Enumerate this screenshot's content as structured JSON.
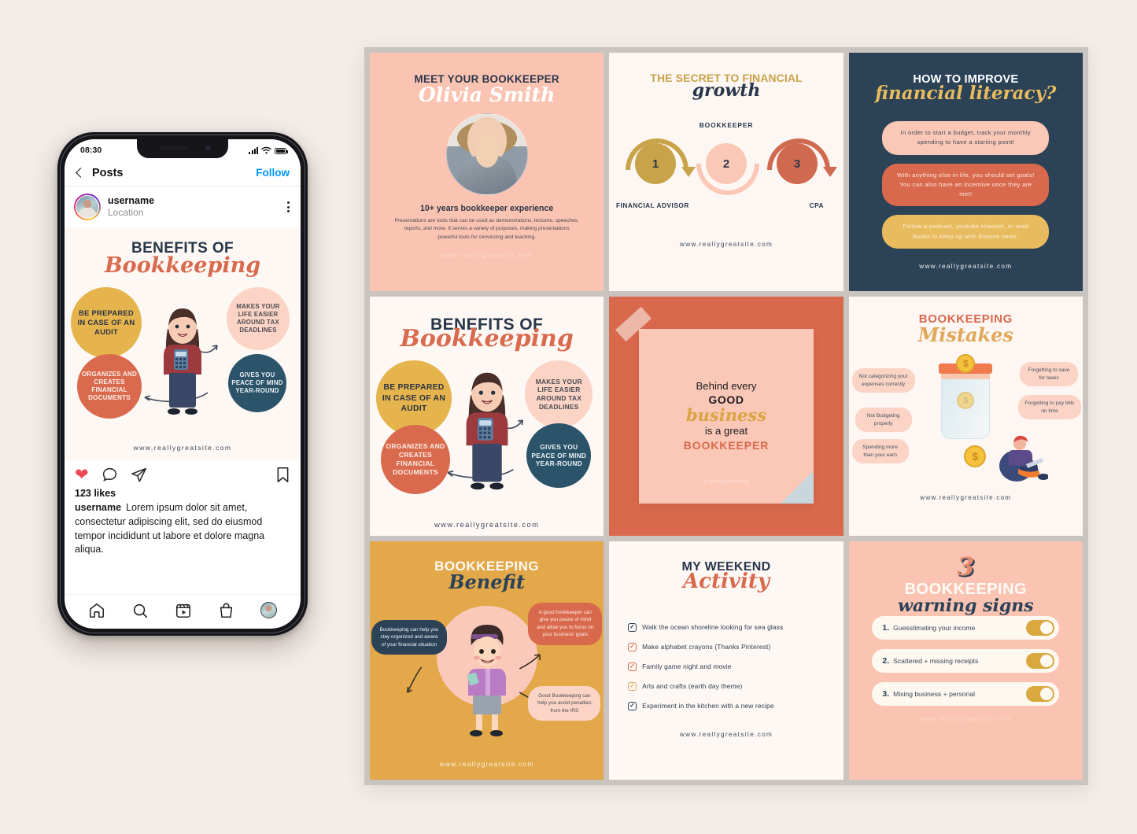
{
  "phone": {
    "status": {
      "time": "08:30",
      "signal_icon": "signal-bars-icon",
      "wifi_icon": "wifi-icon",
      "battery_icon": "battery-icon"
    },
    "header": {
      "back_icon": "back-chevron-icon",
      "title": "Posts",
      "follow_label": "Follow"
    },
    "post": {
      "username": "username",
      "location": "Location",
      "more_icon": "kebab-menu-icon",
      "like_icon": "heart-icon",
      "comment_icon": "comment-icon",
      "share_icon": "send-icon",
      "save_icon": "bookmark-icon",
      "likes": "123 likes",
      "caption_user": "username",
      "caption_text": "Lorem ipsum dolor sit amet, consectetur adipiscing elit, sed do eiusmod tempor incididunt ut labore et dolore magna aliqua."
    },
    "tabbar": [
      {
        "name": "home-icon"
      },
      {
        "name": "search-icon"
      },
      {
        "name": "reels-icon"
      },
      {
        "name": "shop-icon"
      },
      {
        "name": "profile-avatar"
      }
    ]
  },
  "grid": {
    "meet": {
      "title": "MEET YOUR BOOKKEEPER",
      "name": "Olivia Smith",
      "experience": "10+ years bookkeeper experience",
      "body": "Presentations are tools that can be used as demonstrations, lectures, speeches, reports, and more. It serves a variety of purposes, making presentations powerful tools for convincing and teaching.",
      "url": "www.reallygreatsite.com"
    },
    "secret": {
      "title_line1": "THE SECRET TO FINANCIAL",
      "title_line2": "growth",
      "top_label": "BOOKKEEPER",
      "steps": [
        {
          "number": "1",
          "label": "FINANCIAL ADVISOR",
          "color": "#c9a349"
        },
        {
          "number": "2",
          "label": "BOOKKEEPER",
          "color": "#fbc7b6"
        },
        {
          "number": "3",
          "label": "CPA",
          "color": "#cf6a50"
        }
      ],
      "label_left": "FINANCIAL ADVISOR",
      "label_right": "CPA",
      "url": "www.reallygreatsite.com"
    },
    "literacy": {
      "title_line1": "HOW TO IMPROVE",
      "title_line2": "financial literacy?",
      "tips": [
        "In order to start a budget, track your monthly spending to have a starting point!",
        "With anything else in life, you should set goals! You can also have an incentive once they are met!",
        "Follow a podcast, youtube channel, or read books to keep up with finance news."
      ],
      "url": "www.reallygreatsite.com"
    },
    "benefits": {
      "title_line1": "BENEFITS OF",
      "title_line2": "Bookkeeping",
      "bubbles": [
        {
          "text": "BE PREPARED IN CASE OF AN AUDIT",
          "color": "#e5b44c"
        },
        {
          "text": "MAKES YOUR LIFE EASIER AROUND TAX DEADLINES",
          "color": "#fbd4c6"
        },
        {
          "text": "ORGANIZES AND CREATES FINANCIAL DOCUMENTS",
          "color": "#d96a4e"
        },
        {
          "text": "GIVES YOU PEACE OF MIND YEAR-ROUND",
          "color": "#2b5369"
        }
      ],
      "url": "www.reallygreatsite.com"
    },
    "quote": {
      "line1": "Behind every",
      "line2": "GOOD",
      "line3": "business",
      "line4": "is a great",
      "line5": "BOOKKEEPER",
      "handle": "@reallygreatsite"
    },
    "mistakes": {
      "title_line1": "BOOKKEEPING",
      "title_line2": "Mistakes",
      "items": [
        "Not categorizing your expenses correctly",
        "Not Budgeting properly",
        "Spending more than your earn",
        "Forgetting to save for taxes",
        "Forgetting to pay bills on time"
      ],
      "url": "www.reallygreatsite.com"
    },
    "bkbenefit": {
      "title_line1": "BOOKKEEPING",
      "title_line2": "Benefit",
      "bubbles": [
        "Bookkeeping can help you stay organized and aware of your financial situation",
        "A good bookkeeper can give you peace of mind and allow you to focus on your business' goals",
        "Good Bookkeeping can help you avoid penalties from the IRS"
      ],
      "url": "www.reallygreatsite.com"
    },
    "weekend": {
      "title_line1": "MY WEEKEND",
      "title_line2": "Activity",
      "items": [
        {
          "text": "Walk the ocean shoreline looking for sea glass",
          "color": "#2b4257"
        },
        {
          "text": "Make alphabet crayons (Thanks Pinterest)",
          "color": "#d9694c"
        },
        {
          "text": "Family game night and movie",
          "color": "#d9694c"
        },
        {
          "text": "Arts and crafts (earth day theme)",
          "color": "#e0a858"
        },
        {
          "text": "Experiment in the kitchen with a new recipe",
          "color": "#2b4257"
        }
      ],
      "url": "www.reallygreatsite.com"
    },
    "warning": {
      "big_number": "3",
      "title_line1": "BOOKKEEPING",
      "title_line2": "warning signs",
      "rows": [
        {
          "num": "1.",
          "text": "Guesstimating your income"
        },
        {
          "num": "2.",
          "text": "Scattered + missing receipts"
        },
        {
          "num": "3.",
          "text": "Mixing business + personal"
        }
      ],
      "url": "www.reallygreatsite.com"
    }
  },
  "colors": {
    "background": "#f3ece7",
    "grid_gap": "#c9c4c0",
    "navy": "#2b4257",
    "terracotta": "#d9694c",
    "gold": "#c9a349",
    "blush": "#fbc4b2",
    "cream": "#fdf8f4",
    "instagram_blue": "#0095f6",
    "like_red": "#ed4956"
  }
}
